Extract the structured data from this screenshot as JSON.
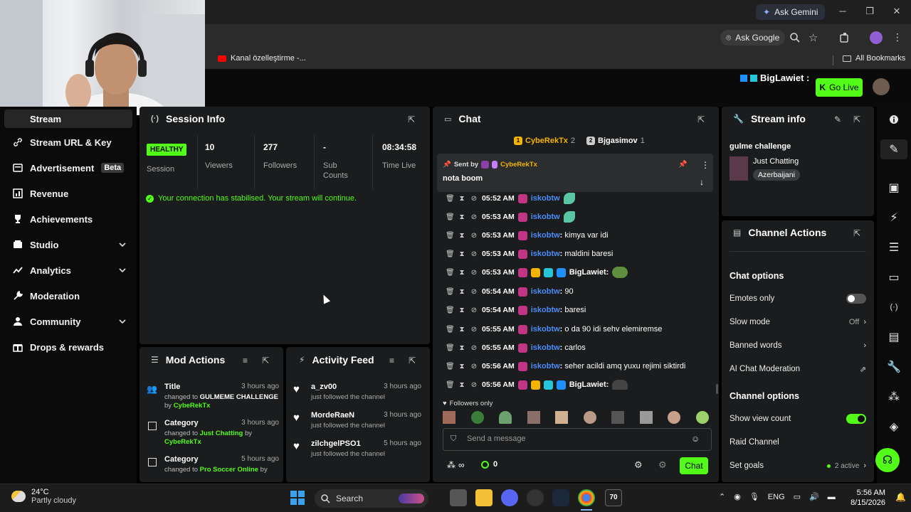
{
  "browser": {
    "gemini_label": "Ask Gemini",
    "ask_google_label": "Ask Google",
    "bookmark_1": "Kanal özelleştirme -...",
    "all_bookmarks": "All Bookmarks"
  },
  "topbar": {
    "username": "BigLawiet :",
    "go_live": "Go Live"
  },
  "sidebar": {
    "items": [
      {
        "label": "Stream"
      },
      {
        "label": "Stream URL & Key"
      },
      {
        "label": "Advertisement",
        "badge": "Beta"
      },
      {
        "label": "Revenue"
      },
      {
        "label": "Achievements"
      },
      {
        "label": "Studio"
      },
      {
        "label": "Analytics"
      },
      {
        "label": "Moderation"
      },
      {
        "label": "Community"
      },
      {
        "label": "Drops & rewards"
      }
    ]
  },
  "session": {
    "title": "Session Info",
    "status": "HEALTHY",
    "status_label": "Session",
    "viewers": "10",
    "viewers_label": "Viewers",
    "followers": "277",
    "followers_label": "Followers",
    "subs": "-",
    "subs_label": "Sub Counts",
    "time_live": "08:34:58",
    "time_live_label": "Time Live",
    "message": "Your connection has stabilised. Your stream will continue."
  },
  "mod_actions": {
    "title": "Mod Actions",
    "rows": [
      {
        "type": "Title",
        "time": "3 hours ago",
        "pre": "changed to ",
        "value": "GULMEME CHALLENGE",
        "by": "by ",
        "user": "CybeRekTx"
      },
      {
        "type": "Category",
        "time": "3 hours ago",
        "pre": "changed to ",
        "value": "Just Chatting",
        "by": " by ",
        "user": "CybeRekTx"
      },
      {
        "type": "Category",
        "time": "5 hours ago",
        "pre": "changed to ",
        "value": "Pro Soccer Online",
        "by": " by",
        "user": ""
      }
    ]
  },
  "activity": {
    "title": "Activity Feed",
    "rows": [
      {
        "name": "a_zv00",
        "time": "3 hours ago",
        "sub": "just followed the channel"
      },
      {
        "name": "MordeRaeN",
        "time": "3 hours ago",
        "sub": "just followed the channel"
      },
      {
        "name": "zilchgelPSO1",
        "time": "5 hours ago",
        "sub": "just followed the channel"
      }
    ]
  },
  "chat": {
    "title": "Chat",
    "top_chatters": [
      {
        "name": "CybeRekTx",
        "count": "2"
      },
      {
        "name": "Bjgasimov",
        "count": "1"
      }
    ],
    "pinned_label": "Sent by",
    "pinned_user": "CybeRekTx",
    "pinned_message": "nota boom",
    "messages": [
      {
        "time": "05:52 AM",
        "user": "iskobtw",
        "text": ""
      },
      {
        "time": "05:53 AM",
        "user": "iskobtw",
        "text": ""
      },
      {
        "time": "05:53 AM",
        "user": "iskobtw",
        "text": "kimya var idi"
      },
      {
        "time": "05:53 AM",
        "user": "iskobtw",
        "text": "maldini baresi"
      },
      {
        "time": "05:53 AM",
        "user": "BigLawiet",
        "text": ""
      },
      {
        "time": "05:54 AM",
        "user": "iskobtw",
        "text": "90"
      },
      {
        "time": "05:54 AM",
        "user": "iskobtw",
        "text": "baresi"
      },
      {
        "time": "05:55 AM",
        "user": "iskobtw",
        "text": "o da 90 idi sehv elemiremse"
      },
      {
        "time": "05:55 AM",
        "user": "iskobtw",
        "text": "carlos"
      },
      {
        "time": "05:56 AM",
        "user": "iskobtw",
        "text": "seher acildi amq yuxu rejimi siktirdi"
      },
      {
        "time": "05:56 AM",
        "user": "BigLawiet",
        "text": ""
      }
    ],
    "followers_only": "Followers only",
    "input_placeholder": "Send a message",
    "infinity": "∞",
    "points": "0",
    "send_label": "Chat"
  },
  "stream_info": {
    "title": "Stream info",
    "stream_title": "gulme challenge",
    "category": "Just Chatting",
    "tag": "Azerbaijani"
  },
  "channel_actions": {
    "title": "Channel Actions",
    "chat_options_title": "Chat options",
    "emotes_only": "Emotes only",
    "slow_mode": "Slow mode",
    "slow_mode_value": "Off",
    "banned_words": "Banned words",
    "ai_moderation": "AI Chat Moderation",
    "channel_options_title": "Channel options",
    "show_view_count": "Show view count",
    "raid_channel": "Raid Channel",
    "set_goals": "Set goals",
    "goals_active": "2 active"
  },
  "taskbar": {
    "temp": "24°C",
    "weather": "Partly cloudy",
    "search": "Search",
    "lang": "ENG",
    "time": "5:56 AM",
    "date": "8/15/2026"
  },
  "colors": {
    "accent": "#53fc18",
    "panel": "#1a1c1d",
    "username_blue": "#4b8cf7"
  }
}
